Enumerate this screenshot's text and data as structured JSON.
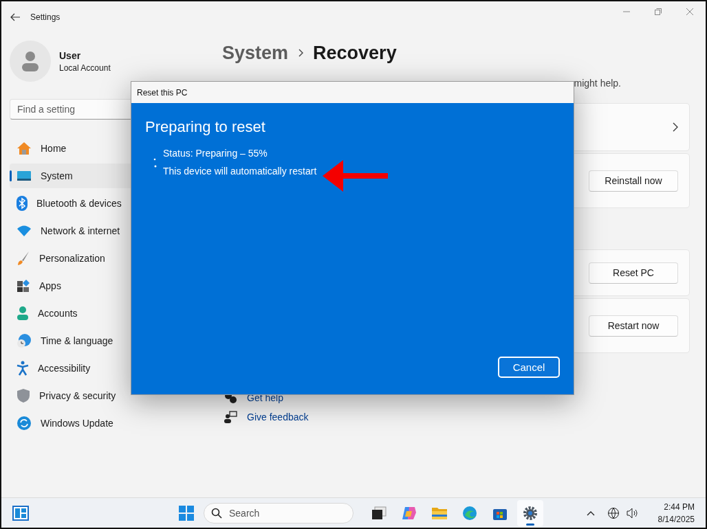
{
  "window": {
    "title": "Settings"
  },
  "profile": {
    "name": "User",
    "account": "Local Account"
  },
  "search": {
    "placeholder": "Find a setting"
  },
  "sidebar": {
    "items": [
      {
        "label": "Home",
        "selected": false
      },
      {
        "label": "System",
        "selected": true
      },
      {
        "label": "Bluetooth & devices",
        "selected": false
      },
      {
        "label": "Network & internet",
        "selected": false
      },
      {
        "label": "Personalization",
        "selected": false
      },
      {
        "label": "Apps",
        "selected": false
      },
      {
        "label": "Accounts",
        "selected": false
      },
      {
        "label": "Time & language",
        "selected": false
      },
      {
        "label": "Accessibility",
        "selected": false
      },
      {
        "label": "Privacy & security",
        "selected": false
      },
      {
        "label": "Windows Update",
        "selected": false
      }
    ]
  },
  "page": {
    "breadcrumb": [
      {
        "label": "System"
      },
      {
        "label": "Recovery"
      }
    ],
    "description": "might help.",
    "card_groups": [
      [
        {
          "kind": "link"
        },
        {
          "kind": "action",
          "button": "Reinstall now"
        }
      ],
      [
        {
          "kind": "action",
          "button": "Reset PC"
        },
        {
          "kind": "action",
          "button": "Restart now"
        }
      ]
    ],
    "links": [
      {
        "label": "Get help"
      },
      {
        "label": "Give feedback"
      }
    ]
  },
  "dialog": {
    "title": "Reset this PC",
    "heading": "Preparing to reset",
    "status": "Status: Preparing – 55%",
    "note": "This device will automatically restart",
    "cancel": "Cancel"
  },
  "taskbar": {
    "search_placeholder": "Search",
    "apps": [
      {
        "selected": false
      },
      {
        "selected": false
      },
      {
        "selected": false
      },
      {
        "selected": false
      },
      {
        "selected": false
      },
      {
        "selected": true
      }
    ],
    "time": "2:44 PM",
    "date": "8/14/2025"
  }
}
